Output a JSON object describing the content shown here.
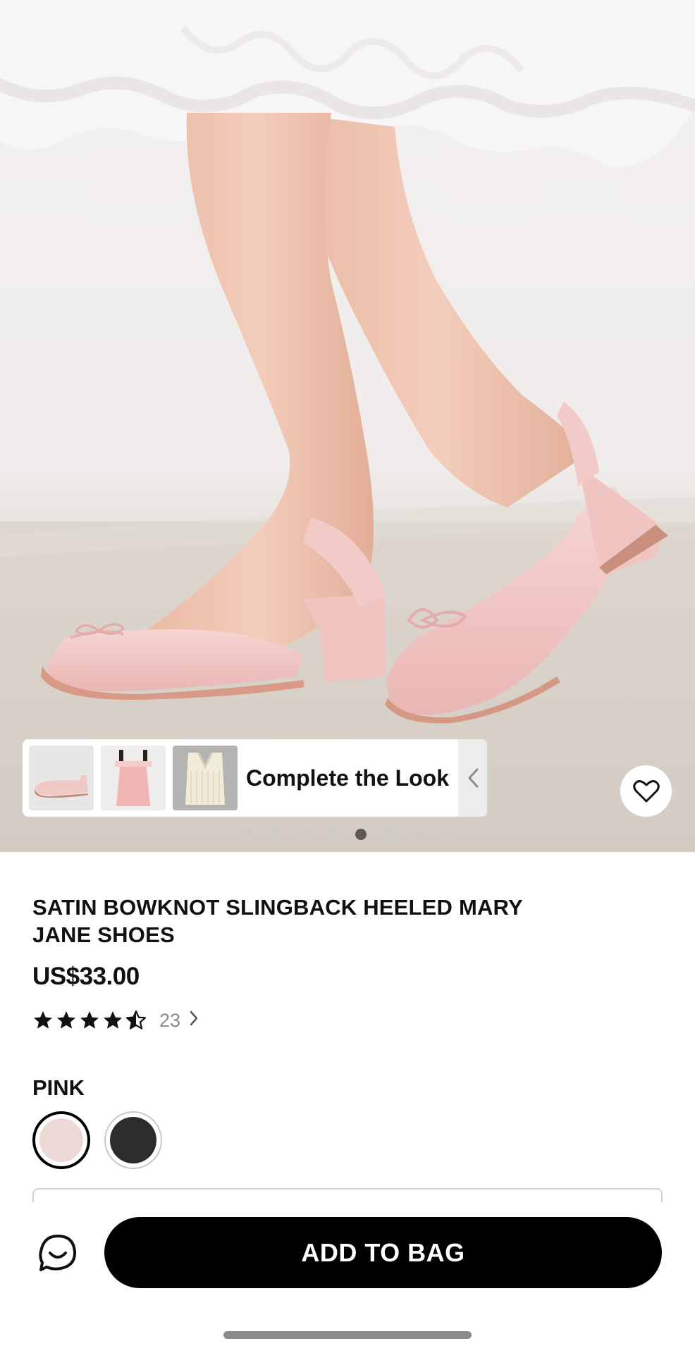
{
  "product": {
    "title": "SATIN BOWKNOT SLINGBACK HEELED MARY JANE SHOES",
    "price": "US$33.00",
    "rating": 4.5,
    "review_count": "23"
  },
  "gallery": {
    "image_count": 8,
    "active_index": 4,
    "complete_the_look": {
      "label": "Complete the Look"
    }
  },
  "color": {
    "selected_name": "PINK",
    "options": [
      {
        "name": "pink",
        "hex": "#ecd8d6",
        "selected": true
      },
      {
        "name": "black",
        "hex": "#2d2c2c",
        "selected": false
      }
    ]
  },
  "actions": {
    "add_to_bag": "ADD TO BAG"
  },
  "icons": {
    "favorite": "heart-icon",
    "chat": "chat-icon",
    "review_chevron": "chevron-right-icon",
    "ctl_arrow": "chevron-left-icon"
  },
  "colors": {
    "shoe_pink": "#f0c9c7",
    "accent": "#000000"
  }
}
